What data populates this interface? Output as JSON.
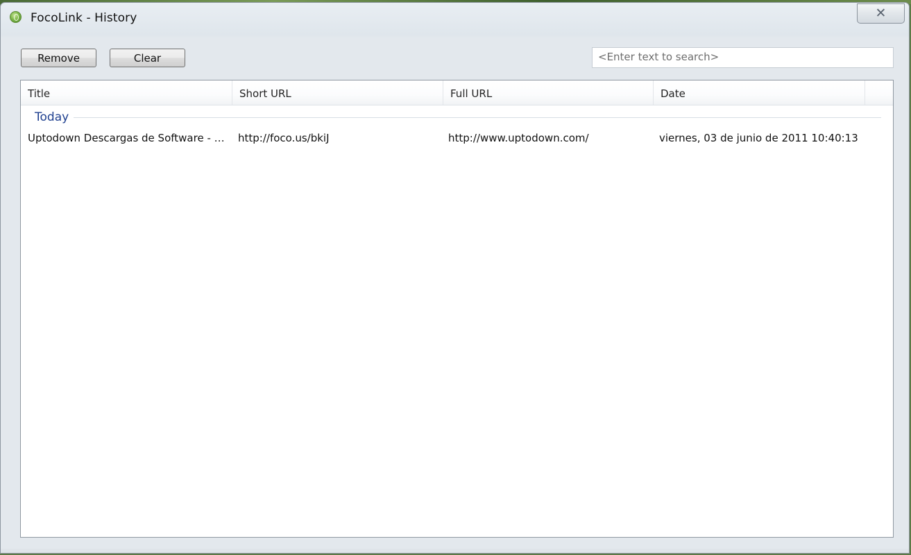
{
  "window": {
    "title": "FocoLink - History",
    "close_glyph": "✕"
  },
  "toolbar": {
    "remove_label": "Remove",
    "clear_label": "Clear"
  },
  "search": {
    "placeholder": "<Enter text to search>"
  },
  "table": {
    "columns": [
      "Title",
      "Short URL",
      "Full URL",
      "Date"
    ],
    "groups": [
      {
        "label": "Today",
        "rows": [
          {
            "title": "Uptodown Descargas de Software - D...",
            "short_url": "http://foco.us/bkiJ",
            "full_url": "http://www.uptodown.com/",
            "date": "viernes, 03 de junio de 2011 10:40:13"
          }
        ]
      }
    ]
  },
  "colors": {
    "group_label": "#1e3f8f",
    "window_frame": "#e3e8ed"
  },
  "icons": {
    "app": "focolink-app-icon",
    "close": "close-icon"
  }
}
